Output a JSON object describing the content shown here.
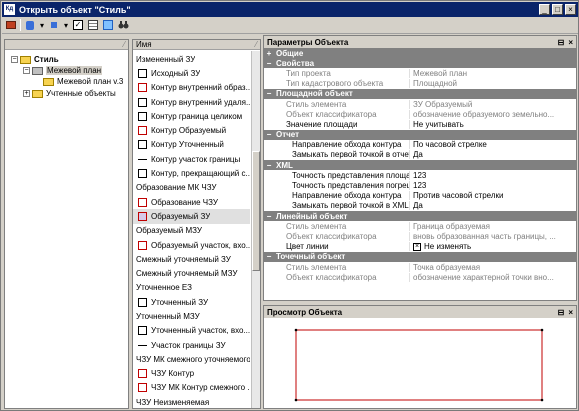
{
  "window": {
    "title": "Открыть объект \"Стиль\"",
    "icon_label": "Кд"
  },
  "toolbar": {
    "buttons": [
      "open-icon",
      "db-icon",
      "new-icon",
      "checkbox-icon",
      "view-icon",
      "binoculars-icon"
    ]
  },
  "tree": {
    "root": "Стиль",
    "nodes": [
      {
        "label": "Межевой план",
        "level": 1
      },
      {
        "label": "Межевой план v.3",
        "level": 2
      },
      {
        "label": "Учтенные объекты",
        "level": 1
      }
    ]
  },
  "list": {
    "header": "Имя",
    "rows": [
      {
        "text": "Измененный ЗУ",
        "kind": "group"
      },
      {
        "text": "Исходный ЗУ",
        "kind": "item",
        "swatch": "#000000",
        "swatch_type": "box"
      },
      {
        "text": "Контур внутренний образ...",
        "kind": "item",
        "swatch": "#c00000",
        "swatch_type": "box"
      },
      {
        "text": "Контур внутренний удаля...",
        "kind": "item",
        "swatch": "#000000",
        "swatch_type": "box"
      },
      {
        "text": "Контур граница целиком",
        "kind": "item",
        "swatch": "#000000",
        "swatch_type": "box"
      },
      {
        "text": "Контур Образуемый",
        "kind": "item",
        "swatch": "#c00000",
        "swatch_type": "box"
      },
      {
        "text": "Контур Уточненный",
        "kind": "item",
        "swatch": "#000000",
        "swatch_type": "box"
      },
      {
        "text": "Контур участок границы",
        "kind": "item",
        "swatch": "#000000",
        "swatch_type": "line"
      },
      {
        "text": "Контур, прекращающий с...",
        "kind": "item",
        "swatch": "#000000",
        "swatch_type": "box"
      },
      {
        "text": "Образование МК ЧЗУ",
        "kind": "group"
      },
      {
        "text": "Образование ЧЗУ",
        "kind": "item",
        "swatch": "#c00000",
        "swatch_type": "box"
      },
      {
        "text": "Образуемый ЗУ",
        "kind": "item",
        "swatch": "#c00000",
        "swatch_type": "box",
        "selected": true
      },
      {
        "text": "Образуемый МЗУ",
        "kind": "group"
      },
      {
        "text": "Образуемый участок, вхо...",
        "kind": "item",
        "swatch": "#c00000",
        "swatch_type": "box"
      },
      {
        "text": "Смежный уточняемый ЗУ",
        "kind": "group"
      },
      {
        "text": "Смежный уточняемый МЗУ",
        "kind": "group"
      },
      {
        "text": "Уточненное ЕЗ",
        "kind": "group"
      },
      {
        "text": "Уточненный ЗУ",
        "kind": "item",
        "swatch": "#000000",
        "swatch_type": "box"
      },
      {
        "text": "Уточненный МЗУ",
        "kind": "group"
      },
      {
        "text": "Уточненный участок, вхо...",
        "kind": "item",
        "swatch": "#000000",
        "swatch_type": "box"
      },
      {
        "text": "Участок границы ЗУ",
        "kind": "item",
        "swatch": "#000000",
        "swatch_type": "line"
      },
      {
        "text": "ЧЗУ МК смежного уточняемого",
        "kind": "group"
      },
      {
        "text": "ЧЗУ Контур",
        "kind": "item",
        "swatch": "#c00000",
        "swatch_type": "box"
      },
      {
        "text": "ЧЗУ МК Контур смежного ...",
        "kind": "item",
        "swatch": "#c00000",
        "swatch_type": "box"
      },
      {
        "text": "ЧЗУ Неизменяемая",
        "kind": "group"
      }
    ]
  },
  "props": {
    "title": "Параметры Объекта",
    "rows": [
      {
        "kind": "cat",
        "mark": "+",
        "k": "Общие"
      },
      {
        "kind": "cat",
        "mark": "−",
        "k": "Свойства"
      },
      {
        "kind": "ro",
        "k": "Тип проекта",
        "v": "Межевой план"
      },
      {
        "kind": "ro",
        "k": "Тип кадастрового объекта",
        "v": "Площадной"
      },
      {
        "kind": "cat",
        "mark": "−",
        "k": "Площадной объект"
      },
      {
        "kind": "ro",
        "k": "Стиль элемента",
        "v": "ЗУ Образуемый"
      },
      {
        "kind": "ro",
        "k": "Объект классификатора",
        "v": "обозначение образуемого земельно..."
      },
      {
        "kind": "rw",
        "k": "Значение площади",
        "v": "Не учитывать"
      },
      {
        "kind": "cat",
        "mark": "−",
        "k": "Отчет"
      },
      {
        "kind": "sub",
        "k": "Направление обхода контура",
        "v": "По часовой стрелке"
      },
      {
        "kind": "sub",
        "k": "Замыкать первой точкой в отчете",
        "v": "Да"
      },
      {
        "kind": "cat",
        "mark": "−",
        "k": "XML"
      },
      {
        "kind": "sub",
        "k": "Точность представления площади",
        "v": "123"
      },
      {
        "kind": "sub",
        "k": "Точность представления погрешност...",
        "v": "123"
      },
      {
        "kind": "sub",
        "k": "Направление обхода контура",
        "v": "Против часовой стрелки"
      },
      {
        "kind": "sub",
        "k": "Замыкать первой точкой в XML",
        "v": "Да"
      },
      {
        "kind": "cat",
        "mark": "−",
        "k": "Линейный объект"
      },
      {
        "kind": "ro",
        "k": "Стиль элемента",
        "v": "Граница образуемая"
      },
      {
        "kind": "ro",
        "k": "Объект классификатора",
        "v": "вновь образованная часть границы, ..."
      },
      {
        "kind": "rw",
        "k": "Цвет линии",
        "v": "Не изменять",
        "checkbox": true
      },
      {
        "kind": "cat",
        "mark": "−",
        "k": "Точечный объект"
      },
      {
        "kind": "ro",
        "k": "Стиль элемента",
        "v": "Точка образуемая"
      },
      {
        "kind": "ro",
        "k": "Объект классификатора",
        "v": "обозначение характерной точки вно..."
      }
    ]
  },
  "preview": {
    "title": "Просмотр Объекта",
    "line_color": "#c00000"
  },
  "colors": {
    "title_bar": "#0a246a",
    "red": "#c00000"
  }
}
